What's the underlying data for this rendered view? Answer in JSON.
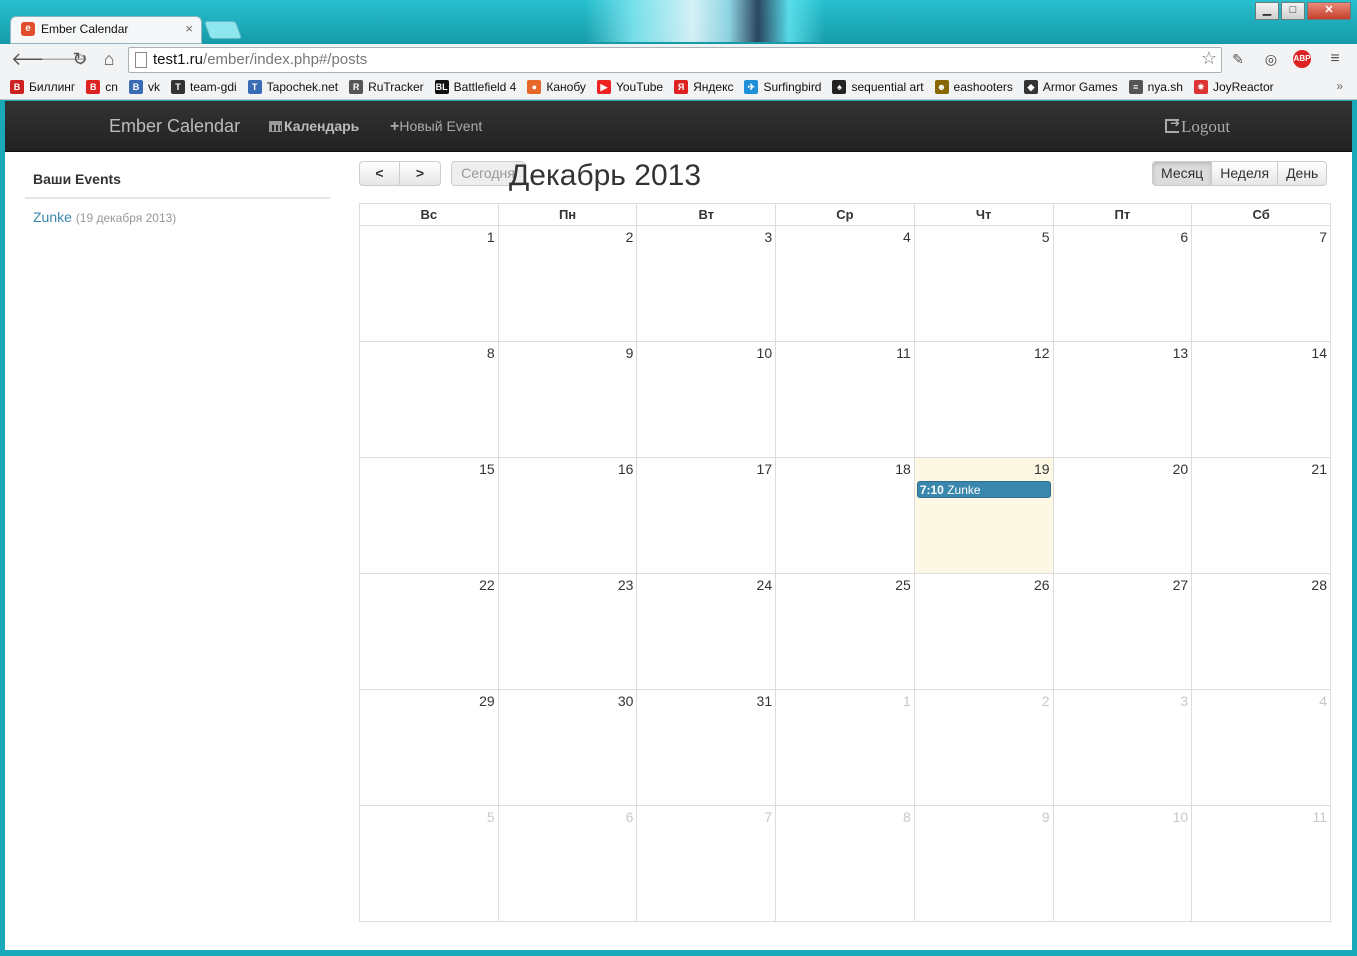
{
  "browser": {
    "tab_title": "Ember Calendar",
    "tab_favicon": "e",
    "url_host": "test1.ru",
    "url_path": "/ember/index.php#/posts",
    "bookmarks": [
      "Биллинг",
      "cn",
      "vk",
      "team-gdi",
      "Tapochek.net",
      "RuTracker",
      "Battlefield 4",
      "Канобу",
      "YouTube",
      "Яндекс",
      "Surfingbird",
      "sequential art",
      "eashooters",
      "Armor Games",
      "nya.sh",
      "JoyReactor"
    ],
    "bookmark_colors": [
      "#c22",
      "#d22",
      "#3a6cb5",
      "#333",
      "#3a6cb5",
      "#555",
      "#111",
      "#e7672a",
      "#e22",
      "#d22",
      "#1e8fd8",
      "#222",
      "#886600",
      "#333",
      "#555",
      "#d33"
    ],
    "bookmark_icons": [
      "В",
      "В",
      "B",
      "T",
      "T",
      "R",
      "BL",
      "●",
      "▶",
      "Я",
      "✈",
      "♠",
      "☻",
      "◆",
      "≡",
      "✷"
    ]
  },
  "navbar": {
    "brand": "Ember Calendar",
    "calendar_link": "Календарь",
    "new_event_link": "Новый Event",
    "logout": "Logout"
  },
  "sidebar": {
    "title": "Ваши Events",
    "events": [
      {
        "name": "Zunke",
        "date": "(19 декабря 2013)"
      }
    ]
  },
  "calendar": {
    "today_label": "Сегодня",
    "title": "Декабрь 2013",
    "views": [
      "Месяц",
      "Неделя",
      "День"
    ],
    "active_view": "Месяц",
    "weekdays": [
      "Вс",
      "Пн",
      "Вт",
      "Ср",
      "Чт",
      "Пт",
      "Сб"
    ],
    "weeks": [
      [
        {
          "d": "1"
        },
        {
          "d": "2"
        },
        {
          "d": "3"
        },
        {
          "d": "4"
        },
        {
          "d": "5"
        },
        {
          "d": "6"
        },
        {
          "d": "7"
        }
      ],
      [
        {
          "d": "8"
        },
        {
          "d": "9"
        },
        {
          "d": "10"
        },
        {
          "d": "11"
        },
        {
          "d": "12"
        },
        {
          "d": "13"
        },
        {
          "d": "14"
        }
      ],
      [
        {
          "d": "15"
        },
        {
          "d": "16"
        },
        {
          "d": "17"
        },
        {
          "d": "18"
        },
        {
          "d": "19",
          "today": true,
          "event": {
            "time": "7:10",
            "title": "Zunke"
          }
        },
        {
          "d": "20"
        },
        {
          "d": "21"
        }
      ],
      [
        {
          "d": "22"
        },
        {
          "d": "23"
        },
        {
          "d": "24"
        },
        {
          "d": "25"
        },
        {
          "d": "26"
        },
        {
          "d": "27"
        },
        {
          "d": "28"
        }
      ],
      [
        {
          "d": "29"
        },
        {
          "d": "30"
        },
        {
          "d": "31"
        },
        {
          "d": "1",
          "other": true
        },
        {
          "d": "2",
          "other": true
        },
        {
          "d": "3",
          "other": true
        },
        {
          "d": "4",
          "other": true
        }
      ],
      [
        {
          "d": "5",
          "other": true
        },
        {
          "d": "6",
          "other": true
        },
        {
          "d": "7",
          "other": true
        },
        {
          "d": "8",
          "other": true
        },
        {
          "d": "9",
          "other": true
        },
        {
          "d": "10",
          "other": true
        },
        {
          "d": "11",
          "other": true
        }
      ]
    ]
  }
}
